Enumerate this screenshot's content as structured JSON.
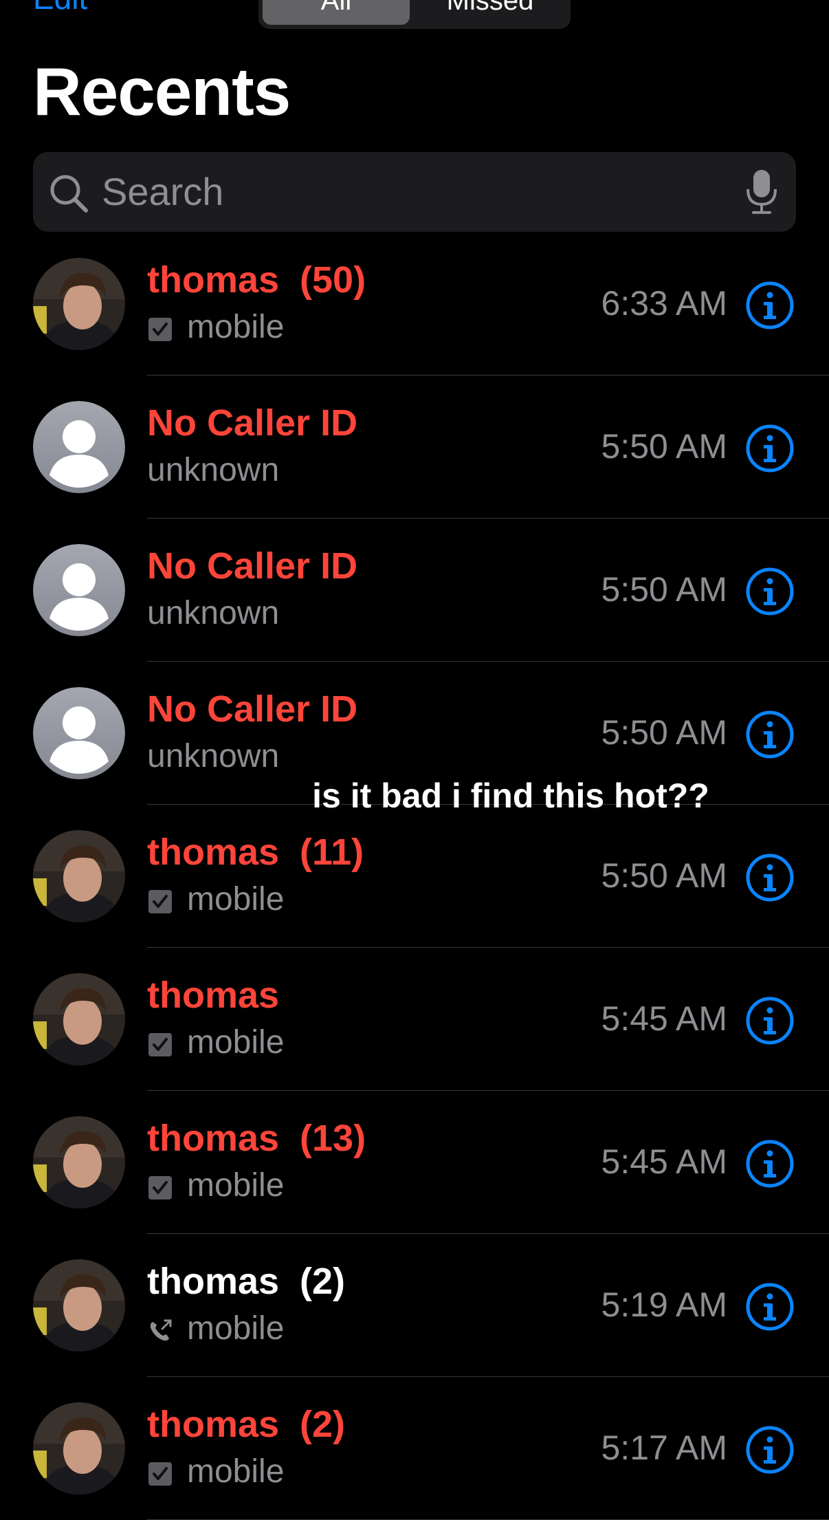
{
  "nav": {
    "edit_label": "Edit",
    "segments": [
      "All",
      "Missed"
    ],
    "selected_segment": "All"
  },
  "page_title": "Recents",
  "search": {
    "placeholder": "Search"
  },
  "overlay_caption": "is it bad i find this hot??",
  "colors": {
    "missed": "#ff453a",
    "accent": "#0a84ff",
    "secondary": "#8e8e93",
    "background": "#000000"
  },
  "calls": [
    {
      "name": "thomas",
      "count": "(50)",
      "missed": true,
      "type": "mobile",
      "type_icon": "checkbox-icon",
      "time": "6:33 AM",
      "avatar": "photo"
    },
    {
      "name": "No Caller ID",
      "count": "",
      "missed": true,
      "type": "unknown",
      "type_icon": "",
      "time": "5:50 AM",
      "avatar": "placeholder"
    },
    {
      "name": "No Caller ID",
      "count": "",
      "missed": true,
      "type": "unknown",
      "type_icon": "",
      "time": "5:50 AM",
      "avatar": "placeholder"
    },
    {
      "name": "No Caller ID",
      "count": "",
      "missed": true,
      "type": "unknown",
      "type_icon": "",
      "time": "5:50 AM",
      "avatar": "placeholder"
    },
    {
      "name": "thomas",
      "count": "(11)",
      "missed": true,
      "type": "mobile",
      "type_icon": "checkbox-icon",
      "time": "5:50 AM",
      "avatar": "photo"
    },
    {
      "name": "thomas",
      "count": "",
      "missed": true,
      "type": "mobile",
      "type_icon": "checkbox-icon",
      "time": "5:45 AM",
      "avatar": "photo"
    },
    {
      "name": "thomas",
      "count": "(13)",
      "missed": true,
      "type": "mobile",
      "type_icon": "checkbox-icon",
      "time": "5:45 AM",
      "avatar": "photo"
    },
    {
      "name": "thomas",
      "count": "(2)",
      "missed": false,
      "type": "mobile",
      "type_icon": "outgoing-call-icon",
      "time": "5:19 AM",
      "avatar": "photo"
    },
    {
      "name": "thomas",
      "count": "(2)",
      "missed": true,
      "type": "mobile",
      "type_icon": "checkbox-icon",
      "time": "5:17 AM",
      "avatar": "photo"
    }
  ]
}
